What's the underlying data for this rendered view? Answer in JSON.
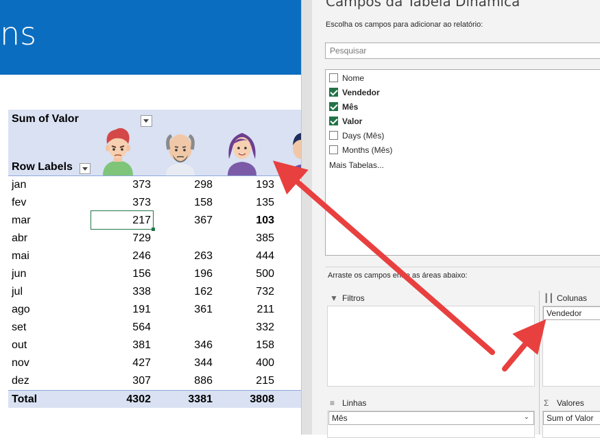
{
  "banner": {
    "text": "ns"
  },
  "pivot": {
    "title": "Sum of Valor",
    "row_labels": "Row Labels",
    "rows": [
      {
        "label": "jan",
        "v1": "373",
        "v2": "298",
        "v3": "193"
      },
      {
        "label": "fev",
        "v1": "373",
        "v2": "158",
        "v3": "135"
      },
      {
        "label": "mar",
        "v1": "217",
        "v2": "367",
        "v3": "103"
      },
      {
        "label": "abr",
        "v1": "729",
        "v2": "",
        "v3": "385"
      },
      {
        "label": "mai",
        "v1": "246",
        "v2": "263",
        "v3": "444"
      },
      {
        "label": "jun",
        "v1": "156",
        "v2": "196",
        "v3": "500"
      },
      {
        "label": "jul",
        "v1": "338",
        "v2": "162",
        "v3": "732"
      },
      {
        "label": "ago",
        "v1": "191",
        "v2": "361",
        "v3": "211"
      },
      {
        "label": "set",
        "v1": "564",
        "v2": "",
        "v3": "332"
      },
      {
        "label": "out",
        "v1": "381",
        "v2": "346",
        "v3": "158"
      },
      {
        "label": "nov",
        "v1": "427",
        "v2": "344",
        "v3": "400"
      },
      {
        "label": "dez",
        "v1": "307",
        "v2": "886",
        "v3": "215"
      }
    ],
    "total": {
      "label": "Total",
      "v1": "4302",
      "v2": "3381",
      "v3": "3808"
    }
  },
  "panel": {
    "title": "Campos da Tabela Dinâmica",
    "choose": "Escolha os campos para adicionar ao relatório:",
    "search_placeholder": "Pesquisar",
    "fields": [
      {
        "label": "Nome",
        "checked": false
      },
      {
        "label": "Vendedor",
        "checked": true
      },
      {
        "label": "Mês",
        "checked": true
      },
      {
        "label": "Valor",
        "checked": true
      },
      {
        "label": "Days (Mês)",
        "checked": false
      },
      {
        "label": "Months (Mês)",
        "checked": false
      }
    ],
    "more_tables": "Mais Tabelas...",
    "drag_text": "Arraste os campos entre as áreas abaixo:",
    "areas": {
      "filters": "Filtros",
      "columns": "Colunas",
      "rows": "Linhas",
      "values": "Valores"
    },
    "columns_chip": "Vendedor",
    "rows_chip": "Mês",
    "values_chip": "Sum of Valor"
  },
  "colors": {
    "banner": "#0b6dbf",
    "pivot_header": "#d9e1f2",
    "excel_green": "#217346",
    "arrow_red": "#e8403f"
  }
}
